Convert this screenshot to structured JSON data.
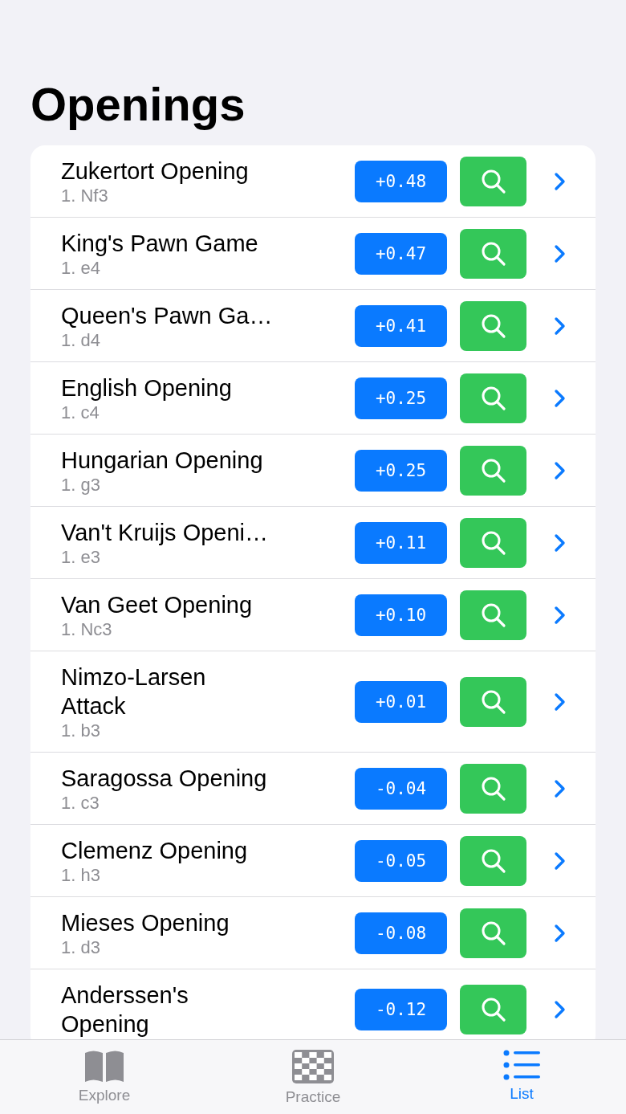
{
  "title": "Openings",
  "openings": [
    {
      "name": "Zukertort Opening",
      "move": "1. Nf3",
      "eval": "+0.48"
    },
    {
      "name": "King's Pawn Game",
      "move": "1. e4",
      "eval": "+0.47"
    },
    {
      "name": "Queen's Pawn Ga…",
      "move": "1. d4",
      "eval": "+0.41"
    },
    {
      "name": "English Opening",
      "move": "1. c4",
      "eval": "+0.25"
    },
    {
      "name": "Hungarian Opening",
      "move": "1. g3",
      "eval": "+0.25"
    },
    {
      "name": "Van't Kruijs Openi…",
      "move": "1. e3",
      "eval": "+0.11"
    },
    {
      "name": "Van Geet Opening",
      "move": "1. Nc3",
      "eval": "+0.10"
    },
    {
      "name": "Nimzo-Larsen\nAttack",
      "move": "1. b3",
      "eval": "+0.01"
    },
    {
      "name": "Saragossa Opening",
      "move": "1. c3",
      "eval": "-0.04"
    },
    {
      "name": "Clemenz Opening",
      "move": "1. h3",
      "eval": "-0.05"
    },
    {
      "name": "Mieses Opening",
      "move": "1. d3",
      "eval": "-0.08"
    },
    {
      "name": "Anderssen's\nOpening",
      "eval": "-0.12"
    }
  ],
  "tabs": [
    {
      "kind": "book",
      "label": "Explore",
      "selected": false
    },
    {
      "kind": "board",
      "label": "Practice",
      "selected": false
    },
    {
      "kind": "list",
      "label": "List",
      "selected": true
    }
  ]
}
